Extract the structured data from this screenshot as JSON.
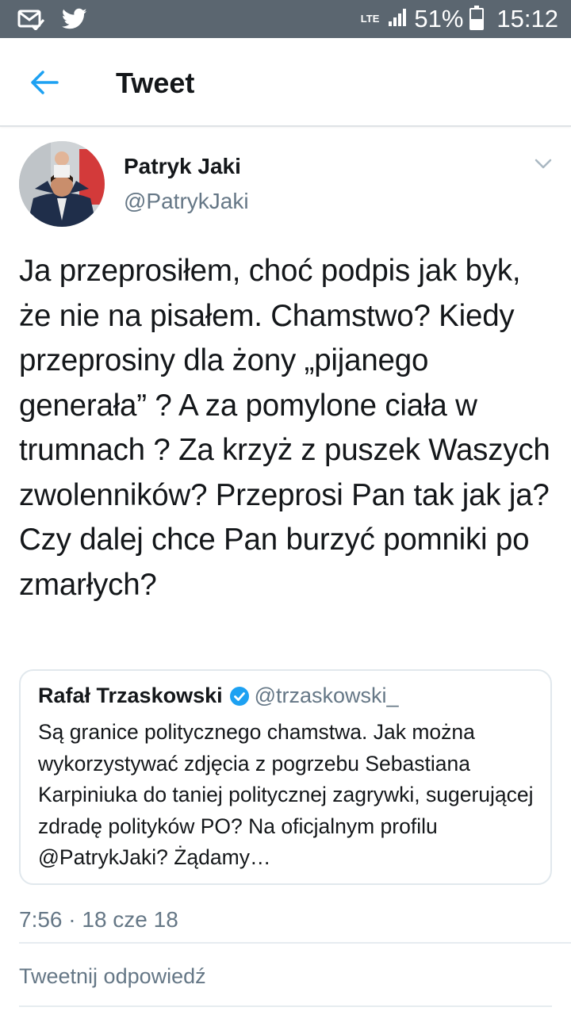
{
  "status_bar": {
    "network": "LTE",
    "battery": "51%",
    "battery_level": 0.51,
    "time": "15:12",
    "icons": [
      "mail-check-icon",
      "twitter-bird-icon",
      "signal-icon",
      "battery-icon"
    ]
  },
  "appbar": {
    "title": "Tweet",
    "back_icon": "arrow-left-icon"
  },
  "tweet": {
    "author_name": "Patryk Jaki",
    "author_handle": "@PatrykJaki",
    "text": "Ja przeprosiłem, choć podpis jak byk, że nie na pisałem. Chamstwo? Kiedy przeprosiny dla żony „pijanego generała” ? A za pomylone ciała w trumnach ? Za krzyż z puszek Waszych zwolenników? Przeprosi Pan tak jak ja? Czy dalej chce Pan burzyć pomniki po zmarłych?",
    "timestamp": "7:56 · 18 cze 18"
  },
  "quote": {
    "author_name": "Rafał Trzaskowski",
    "author_handle": "@trzaskowski_",
    "text": "Są granice politycznego chamstwa. Jak można wykorzystywać zdjęcia z pogrzebu Sebastiana Karpiniuka do taniej politycznej zagrywki, sugerującej zdradę polityków PO? Na oficjalnym profilu @PatrykJaki? Żądamy…"
  },
  "reply": {
    "placeholder": "Tweetnij odpowiedź"
  },
  "colors": {
    "status_bar_bg": "#5b6670",
    "accent": "#1da1f2",
    "secondary_text": "#657786",
    "primary_text": "#14171a"
  }
}
